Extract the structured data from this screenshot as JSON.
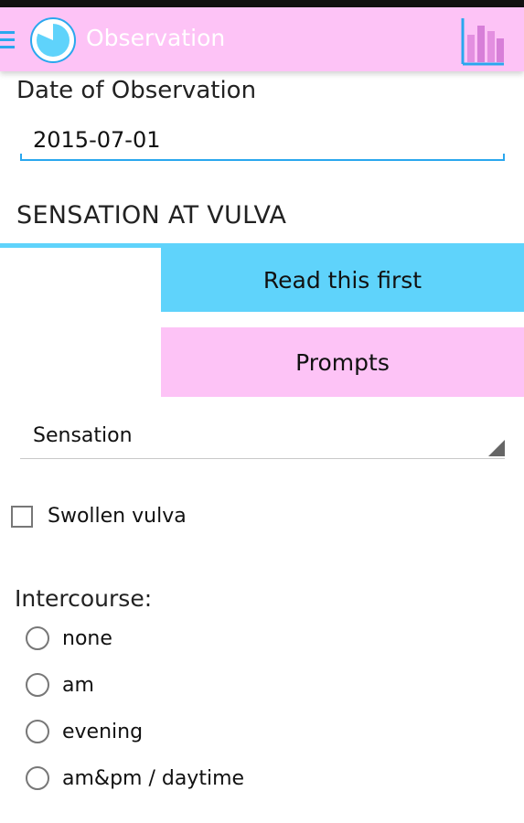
{
  "app_bar": {
    "title": "Observation",
    "menu_icon": "hamburger-icon",
    "logo_icon": "pie-logo-icon",
    "chart_icon": "bar-chart-icon",
    "background": "#fdc3f6",
    "accent": "#2aa7ee"
  },
  "date": {
    "label": "Date of Observation",
    "value": "2015-07-01"
  },
  "section": {
    "title": "SENSATION AT VULVA",
    "accent": "#5fd3fb"
  },
  "buttons": {
    "read_first": "Read this first",
    "prompts": "Prompts"
  },
  "sensation_spinner": {
    "value": "Sensation"
  },
  "swollen": {
    "label": "Swollen vulva",
    "checked": false
  },
  "intercourse": {
    "label": "Intercourse:",
    "options": [
      {
        "label": "none",
        "selected": false
      },
      {
        "label": "am",
        "selected": false
      },
      {
        "label": "evening",
        "selected": false
      },
      {
        "label": "am&pm / daytime",
        "selected": false
      }
    ]
  }
}
